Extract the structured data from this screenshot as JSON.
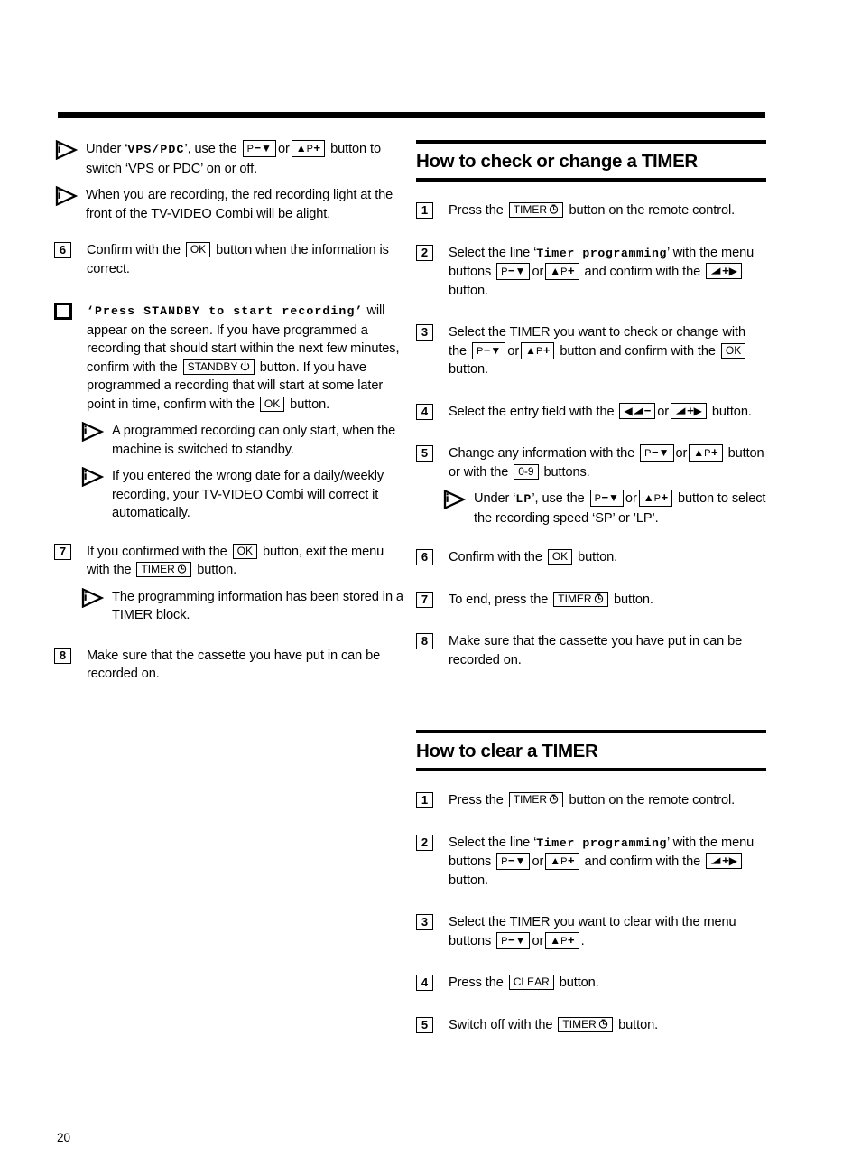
{
  "page": {
    "number": "20"
  },
  "keys": {
    "p_down": "P−▼",
    "p_up": "▲P+",
    "ok": "OK",
    "standby": "STANDBY",
    "timer": "TIMER",
    "vol_down": "◀◺−",
    "vol_up": "◺+▶",
    "digits": "0-9",
    "clear": "CLEAR"
  },
  "icons": {
    "tip": "info-triangle-icon",
    "power": "power-symbol-icon",
    "clock": "clock-timer-icon",
    "volume_wedge": "volume-wedge-icon"
  },
  "left_column": {
    "tip_1": {
      "a": "Under ‘",
      "screen": "VPS/PDC",
      "b": "’, use the",
      "or": "or",
      "c": "button to switch ‘VPS or PDC’ on or off."
    },
    "tip_2": {
      "text": "When you are recording, the red recording light at the front of the TV-VIDEO Combi will be alight."
    },
    "step_6": {
      "marker": "6",
      "a": "Confirm with the",
      "b": "button when the information is correct."
    },
    "step_box": {
      "marker": "",
      "screen": "Press STANDBY to start recording",
      "a": "will appear on the screen. If you have programmed a recording that should start within the next few minutes, confirm with the",
      "b": "button. If you have programmed a recording that will start at some later point in time, confirm with the",
      "c": "button."
    },
    "tip_3": {
      "text": "A programmed recording can only start, when the machine is switched to standby."
    },
    "tip_4": {
      "text": "If you entered the wrong date for a daily/weekly recording, your TV-VIDEO Combi will correct it automatically."
    },
    "step_7": {
      "marker": "7",
      "a": "If you confirmed with the",
      "b": "button, exit the menu with the",
      "c": "button."
    },
    "tip_5": {
      "text": "The programming information has been stored in a TIMER block."
    },
    "step_8": {
      "marker": "8",
      "text": "Make sure that the cassette you have put in can be recorded on."
    }
  },
  "right_column": {
    "heading_check": "How to check or change a TIMER",
    "check_steps": {
      "step_1": {
        "marker": "1",
        "a": "Press the",
        "b": "button on the remote control."
      },
      "step_2": {
        "marker": "2",
        "a": "Select the line ‘",
        "screen": "Timer programming",
        "b": "’ with the menu buttons",
        "or": "or",
        "c": "and confirm with the",
        "d": "button."
      },
      "step_3": {
        "marker": "3",
        "a": "Select the TIMER you want to check or change with the",
        "or": "or",
        "b": "button and confirm with the",
        "c": "button."
      },
      "step_4": {
        "marker": "4",
        "a": "Select the entry field with the",
        "or": "or",
        "b": "button."
      },
      "step_5": {
        "marker": "5",
        "a": "Change any information with the",
        "or": "or",
        "b": "button or with the",
        "c": "buttons."
      },
      "step_5_tip": {
        "a": "Under ‘",
        "screen": "LP",
        "b": "’, use the",
        "or": "or",
        "c": "button to select the recording speed ‘SP’ or ’LP’."
      },
      "step_6": {
        "marker": "6",
        "a": "Confirm with the",
        "b": "button."
      },
      "step_7": {
        "marker": "7",
        "a": "To end, press the",
        "b": "button."
      },
      "step_8": {
        "marker": "8",
        "text": "Make sure that the cassette you have put in can be recorded on."
      }
    },
    "heading_clear": "How to clear a TIMER",
    "clear_steps": {
      "step_1": {
        "marker": "1",
        "a": "Press the",
        "b": "button on the remote control."
      },
      "step_2": {
        "marker": "2",
        "a": "Select the line ‘",
        "screen": "Timer programming",
        "b": "’ with the menu buttons",
        "or": "or",
        "c": "and confirm with the",
        "d": "button."
      },
      "step_3": {
        "marker": "3",
        "a": "Select the TIMER you want to clear with the menu buttons",
        "or": "or",
        "b": "."
      },
      "step_4": {
        "marker": "4",
        "a": "Press the",
        "b": "button."
      },
      "step_5": {
        "marker": "5",
        "a": "Switch off with the",
        "b": "button."
      }
    }
  }
}
